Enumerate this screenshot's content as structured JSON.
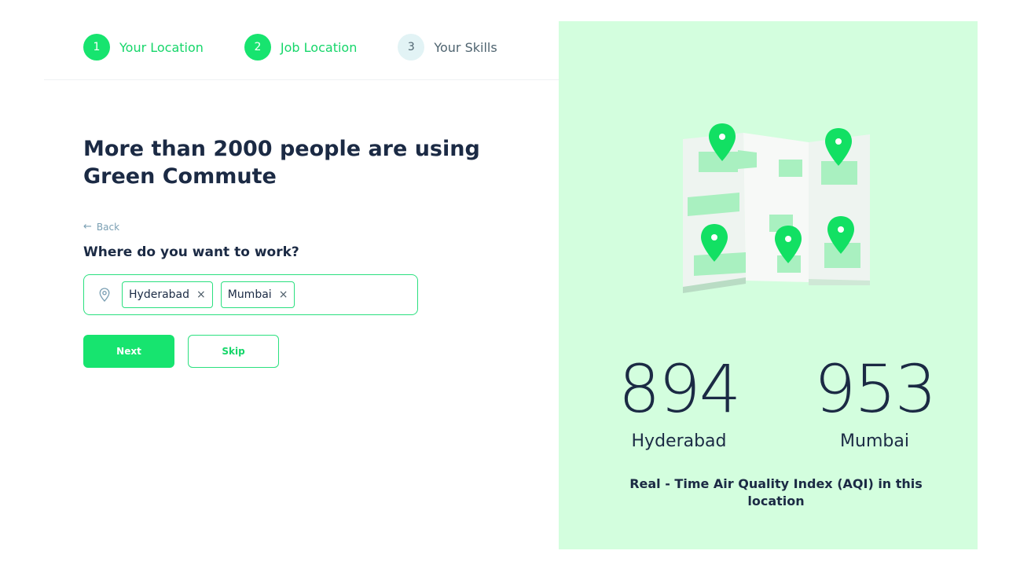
{
  "stepper": {
    "steps": [
      {
        "number": "1",
        "label": "Your Location",
        "state": "active"
      },
      {
        "number": "2",
        "label": "Job Location",
        "state": "active"
      },
      {
        "number": "3",
        "label": "Your Skills",
        "state": "inactive"
      }
    ]
  },
  "main": {
    "headline": "More than 2000 people are using Green Commute",
    "back_label": "Back",
    "question": "Where do you want to work?",
    "location_field": {
      "icon": "location-pin-icon",
      "chips": [
        "Hyderabad",
        "Mumbai"
      ],
      "remove_symbol": "×"
    },
    "next_label": "Next",
    "skip_label": "Skip"
  },
  "panel": {
    "illustration": "map-with-pins-icon",
    "aqi": [
      {
        "value": "894",
        "city": "Hyderabad"
      },
      {
        "value": "953",
        "city": "Mumbai"
      }
    ],
    "caption": "Real - Time Air Quality Index (AQI) in this location"
  },
  "colors": {
    "accent": "#17e46f",
    "accent_text": "#16d66a",
    "panel_bg": "#d3fede",
    "text_dark": "#1b2a44",
    "muted": "#7a9fb3"
  }
}
